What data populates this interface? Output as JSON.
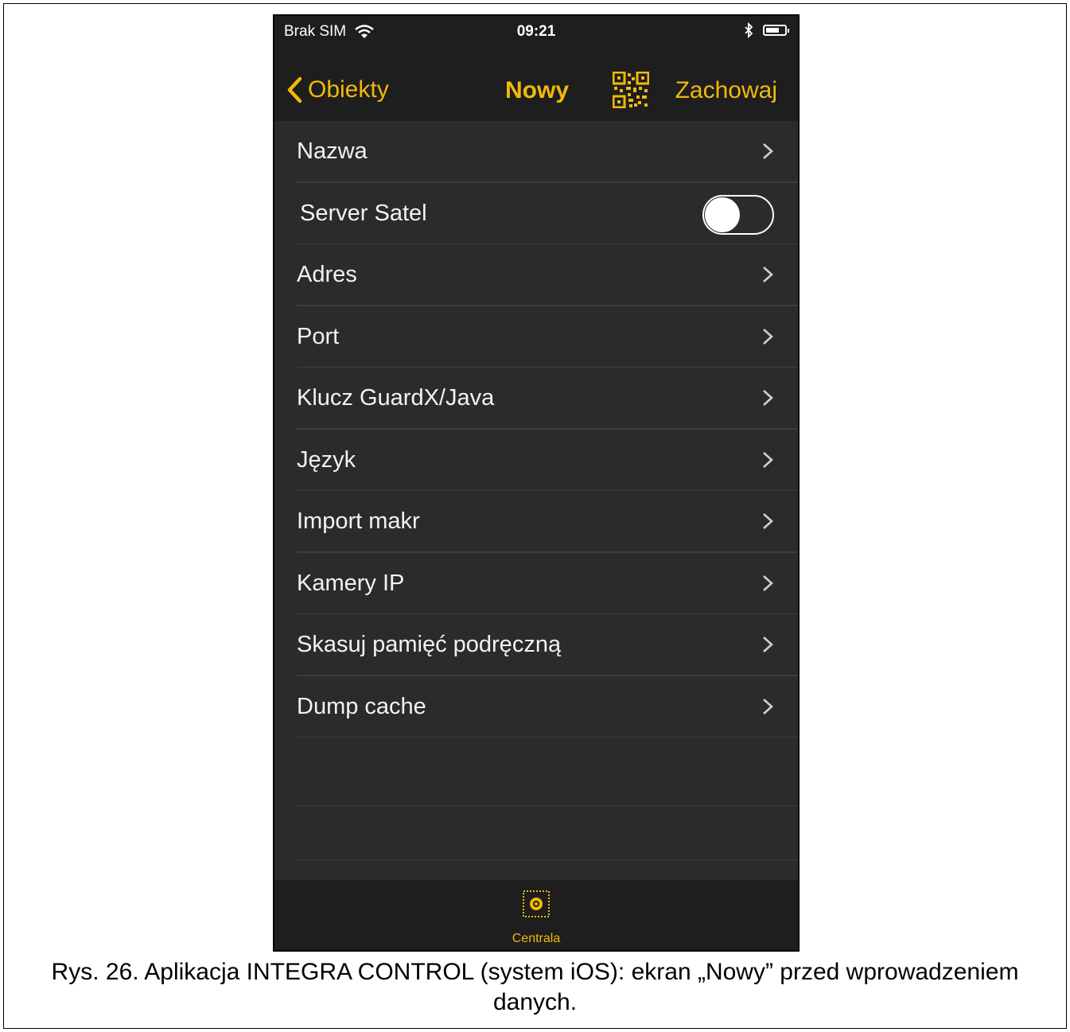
{
  "status_bar": {
    "carrier": "Brak SIM",
    "time": "09:21"
  },
  "nav": {
    "back_label": "Obiekty",
    "title": "Nowy",
    "save_label": "Zachowaj"
  },
  "settings": {
    "items": [
      {
        "label": "Nazwa"
      },
      {
        "label": "Server Satel",
        "toggle": false
      },
      {
        "label": "Adres"
      },
      {
        "label": "Port"
      },
      {
        "label": "Klucz GuardX/Java"
      },
      {
        "label": "Język"
      },
      {
        "label": "Import makr"
      },
      {
        "label": "Kamery IP"
      },
      {
        "label": "Skasuj pamięć podręczną"
      },
      {
        "label": "Dump cache"
      }
    ]
  },
  "tab_bar": {
    "active_tab": "Centrala"
  },
  "caption": {
    "text": "Rys. 26. Aplikacja INTEGRA CONTROL (system iOS): ekran „Nowy” przed wprowadzeniem danych."
  },
  "colors": {
    "accent": "#f0b90b",
    "background": "#2b2b2b",
    "bars": "#1e1e1e"
  }
}
